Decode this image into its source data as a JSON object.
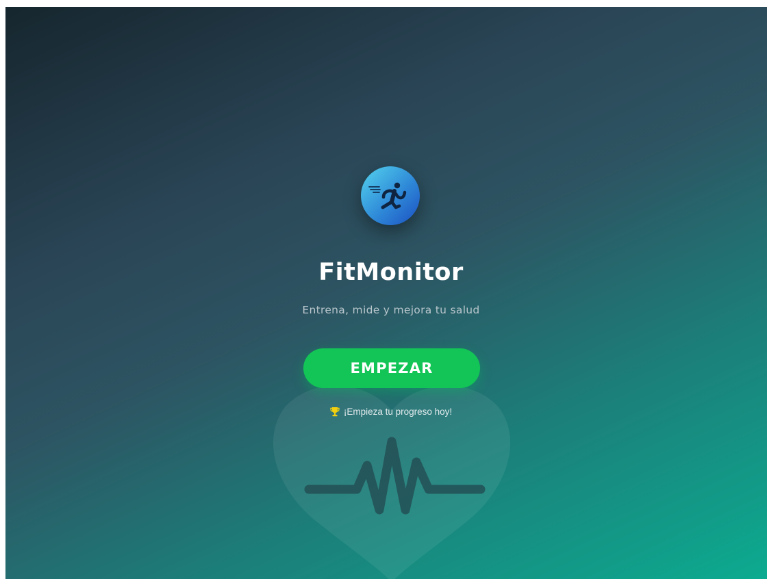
{
  "app": {
    "name": "FitMonitor",
    "tagline": "Entrena, mide y mejora tu salud"
  },
  "cta": {
    "label": "EMPEZAR"
  },
  "motivation": {
    "text": "¡Empieza tu progreso hoy!",
    "icon": "trophy-icon"
  },
  "icons": {
    "logo": "runner-icon",
    "background": "heart-pulse-icon"
  },
  "colors": {
    "background_start": "#16262e",
    "background_end": "#0cab90",
    "primary_button": "#13c556",
    "logo_start": "#54d4ee",
    "logo_end": "#1b4fc2",
    "trophy": "#f2cf0f"
  }
}
